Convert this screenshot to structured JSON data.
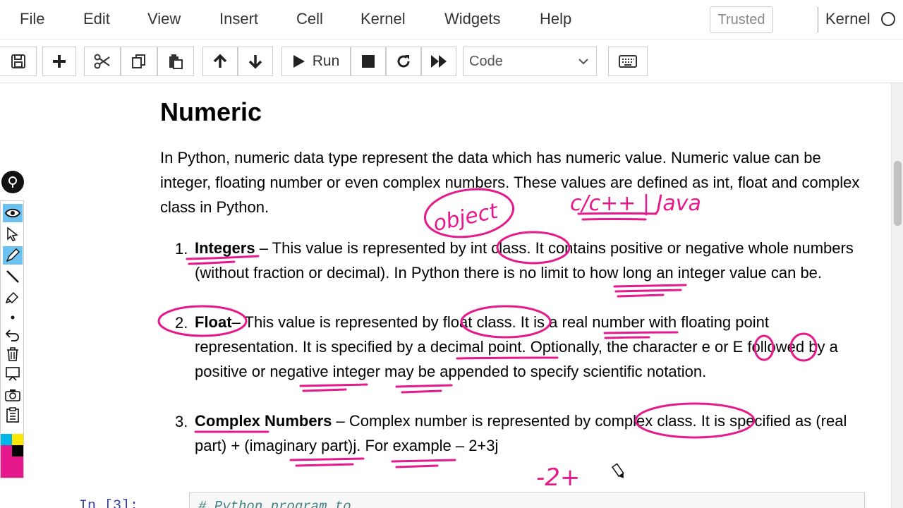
{
  "menu": {
    "items": [
      "File",
      "Edit",
      "View",
      "Insert",
      "Cell",
      "Kernel",
      "Widgets",
      "Help"
    ],
    "trusted": "Trusted",
    "kernel": "Kernel"
  },
  "toolbar": {
    "run_label": "Run",
    "cell_type": "Code",
    "icons": [
      "save-icon",
      "plus-icon",
      "scissors-icon",
      "copy-icon",
      "paste-icon",
      "arrow-up-icon",
      "arrow-down-icon",
      "play-icon",
      "stop-icon",
      "restart-icon",
      "fast-forward-icon",
      "keyboard-icon"
    ]
  },
  "content": {
    "heading": "Numeric",
    "intro": "In Python, numeric data type represent the data which has numeric value. Numeric value can be integer, floating number or even complex numbers. These values are defined as int, float and complex class in Python.",
    "items": [
      {
        "num": "1.",
        "term": "Integers",
        "text": " – This value is represented by int class. It contains positive or negative whole numbers (without fraction or decimal). In Python there is no limit to how long an integer value can be."
      },
      {
        "num": "2.",
        "term": "Float",
        "text": "– This value is represented by float class. It is a real number with floating point representation. It is specified by a decimal point. Optionally, the character e or E followed by a positive or negative integer may be appended to specify scientific notation."
      },
      {
        "num": "3.",
        "term": "Complex Numbers",
        "text": " – Complex number is represented by complex class. It is specified as (real part) + (imaginary part)j. For example – 2+3j"
      }
    ]
  },
  "code_cell": {
    "prompt": "In [3]:",
    "code": "# Python program to"
  },
  "annotations": {
    "object": "object",
    "c_cpp_java": "c/c++ | Java",
    "example": "-2+"
  },
  "colors": {
    "ink": "#e6198c",
    "prompt": "#303f9f",
    "tool_active": "#6bc2f0"
  }
}
